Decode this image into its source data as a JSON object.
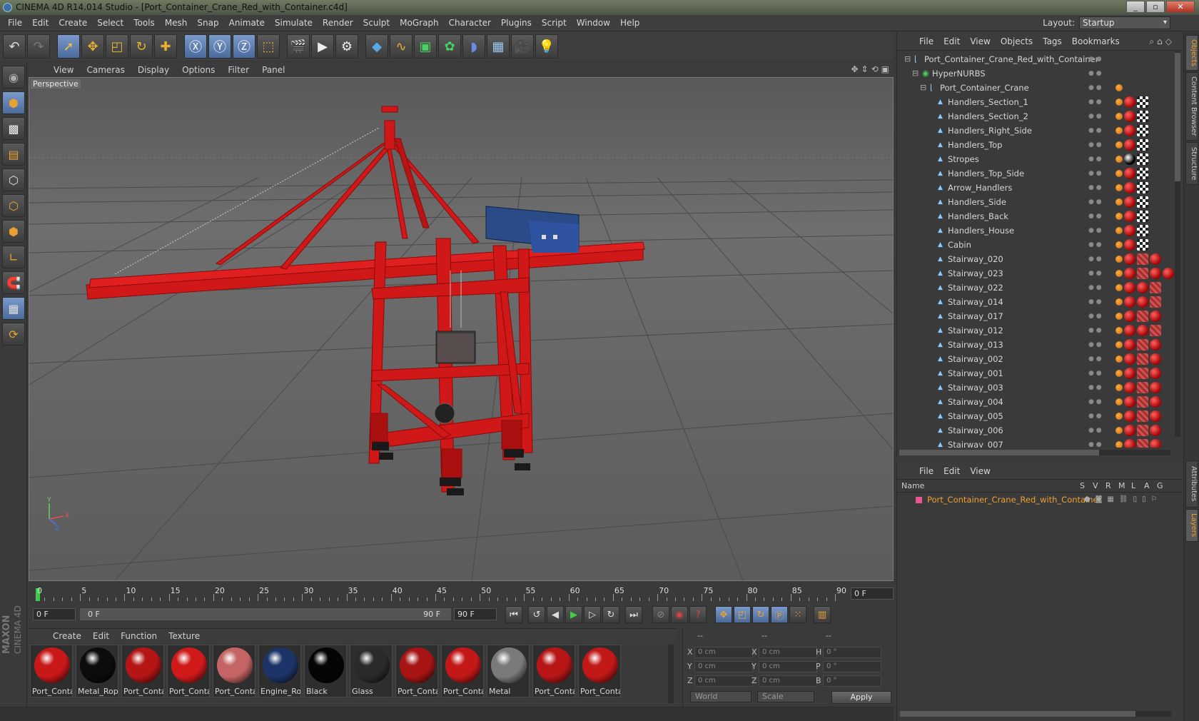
{
  "title": "CINEMA 4D R14.014 Studio - [Port_Container_Crane_Red_with_Container.c4d]",
  "menu": [
    "File",
    "Edit",
    "Create",
    "Select",
    "Tools",
    "Mesh",
    "Snap",
    "Animate",
    "Simulate",
    "Render",
    "Sculpt",
    "MoGraph",
    "Character",
    "Plugins",
    "Script",
    "Window",
    "Help"
  ],
  "layout": {
    "label": "Layout:",
    "value": "Startup"
  },
  "viewport": {
    "menu": [
      "View",
      "Cameras",
      "Display",
      "Options",
      "Filter",
      "Panel"
    ],
    "label": "Perspective"
  },
  "timeline": {
    "ticks": [
      "0",
      "5",
      "10",
      "15",
      "20",
      "25",
      "30",
      "35",
      "40",
      "45",
      "50",
      "55",
      "60",
      "65",
      "70",
      "75",
      "80",
      "85",
      "90"
    ],
    "current_frame": "0 F"
  },
  "transport": {
    "start": "0 F",
    "slider_start": "0 F",
    "slider_end": "90 F",
    "end": "90 F"
  },
  "materials": {
    "menu": [
      "Create",
      "Edit",
      "Function",
      "Texture"
    ],
    "items": [
      {
        "name": "Port_Conta",
        "color": "#c81818"
      },
      {
        "name": "Metal_Rop",
        "color": "#0c0c0c"
      },
      {
        "name": "Port_Conta",
        "color": "#b51515"
      },
      {
        "name": "Port_Conta",
        "color": "#d01a1a"
      },
      {
        "name": "Port_Conta",
        "color": "#c46464"
      },
      {
        "name": "Engine_Ro",
        "color": "#1c3468"
      },
      {
        "name": "Black",
        "color": "#050505"
      },
      {
        "name": "Glass",
        "color": "#2a2a2a"
      },
      {
        "name": "Port_Conta",
        "color": "#a81414"
      },
      {
        "name": "Port_Conta",
        "color": "#c41818"
      },
      {
        "name": "Metal",
        "color": "#7a7a7a"
      },
      {
        "name": "Port_Conta",
        "color": "#b81616"
      },
      {
        "name": "Port_Conta",
        "color": "#c21818"
      }
    ]
  },
  "coords": {
    "headers": [
      "--",
      "--",
      "--"
    ],
    "rows": [
      {
        "a": "X",
        "av": "0 cm",
        "b": "X",
        "bv": "0 cm",
        "c": "H",
        "cv": "0 °"
      },
      {
        "a": "Y",
        "av": "0 cm",
        "b": "Y",
        "bv": "0 cm",
        "c": "P",
        "cv": "0 °"
      },
      {
        "a": "Z",
        "av": "0 cm",
        "b": "Z",
        "bv": "0 cm",
        "c": "B",
        "cv": "0 °"
      }
    ],
    "mode1": "World",
    "mode2": "Scale",
    "apply": "Apply"
  },
  "objects": {
    "menu": [
      "File",
      "Edit",
      "View",
      "Objects",
      "Tags",
      "Bookmarks"
    ],
    "items": [
      {
        "name": "Port_Container_Crane_Red_with_Container",
        "indent": 0,
        "tags": "root"
      },
      {
        "name": "HyperNURBS",
        "indent": 1,
        "tags": "check"
      },
      {
        "name": "Port_Container_Crane",
        "indent": 2,
        "tags": "phong"
      },
      {
        "name": "Handlers_Section_1",
        "indent": 3,
        "tags": "rc"
      },
      {
        "name": "Handlers_Section_2",
        "indent": 3,
        "tags": "rc"
      },
      {
        "name": "Handlers_Right_Side",
        "indent": 3,
        "tags": "rc"
      },
      {
        "name": "Handlers_Top",
        "indent": 3,
        "tags": "rc"
      },
      {
        "name": "Stropes",
        "indent": 3,
        "tags": "bc"
      },
      {
        "name": "Handlers_Top_Side",
        "indent": 3,
        "tags": "rc"
      },
      {
        "name": "Arrow_Handlers",
        "indent": 3,
        "tags": "rc"
      },
      {
        "name": "Handlers_Side",
        "indent": 3,
        "tags": "rc"
      },
      {
        "name": "Handlers_Back",
        "indent": 3,
        "tags": "rc"
      },
      {
        "name": "Handlers_House",
        "indent": 3,
        "tags": "rc"
      },
      {
        "name": "Cabin",
        "indent": 3,
        "tags": "rc"
      },
      {
        "name": "Stairway_020",
        "indent": 3,
        "tags": "rsr"
      },
      {
        "name": "Stairway_023",
        "indent": 3,
        "tags": "rsrr"
      },
      {
        "name": "Stairway_022",
        "indent": 3,
        "tags": "rrs"
      },
      {
        "name": "Stairway_014",
        "indent": 3,
        "tags": "rrs"
      },
      {
        "name": "Stairway_017",
        "indent": 3,
        "tags": "rsr"
      },
      {
        "name": "Stairway_012",
        "indent": 3,
        "tags": "rrs"
      },
      {
        "name": "Stairway_013",
        "indent": 3,
        "tags": "rsr"
      },
      {
        "name": "Stairway_002",
        "indent": 3,
        "tags": "rsr"
      },
      {
        "name": "Stairway_001",
        "indent": 3,
        "tags": "rsr"
      },
      {
        "name": "Stairway_003",
        "indent": 3,
        "tags": "rsr"
      },
      {
        "name": "Stairway_004",
        "indent": 3,
        "tags": "rsr"
      },
      {
        "name": "Stairway_005",
        "indent": 3,
        "tags": "rsr"
      },
      {
        "name": "Stairway_006",
        "indent": 3,
        "tags": "rsr"
      },
      {
        "name": "Stairway_007",
        "indent": 3,
        "tags": "rsr"
      }
    ]
  },
  "layers": {
    "menu": [
      "File",
      "Edit",
      "View"
    ],
    "headers": [
      "Name",
      "S",
      "V",
      "R",
      "M",
      "L",
      "A",
      "G"
    ],
    "item": "Port_Container_Crane_Red_with_Container"
  },
  "right_tabs": [
    "Objects",
    "Content Browser",
    "Structure",
    "Attributes",
    "Layers"
  ],
  "watermark": [
    "MAXON",
    "CINEMA 4D"
  ],
  "axis_labels": [
    "Y",
    "X",
    "Z"
  ]
}
